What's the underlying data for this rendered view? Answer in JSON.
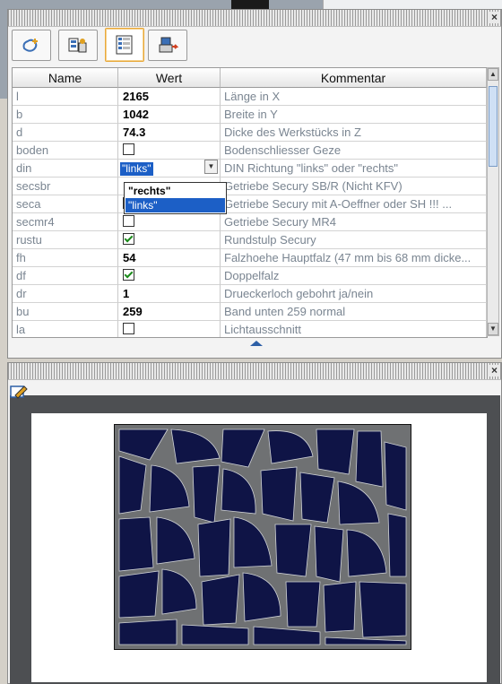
{
  "toolbar_tabs": [
    {
      "icon": "shape-add-icon",
      "active": false
    },
    {
      "icon": "settings-tree-icon",
      "active": false
    },
    {
      "icon": "property-list-icon",
      "active": true
    },
    {
      "icon": "export-icon",
      "active": false
    }
  ],
  "grid": {
    "columns": [
      "Name",
      "Wert",
      "Kommentar"
    ],
    "rows": [
      {
        "name": "l",
        "value": "2165",
        "comment": "Länge in X",
        "type": "text"
      },
      {
        "name": "b",
        "value": "1042",
        "comment": "Breite in Y",
        "type": "text"
      },
      {
        "name": "d",
        "value": "74.3",
        "comment": "Dicke des Werkstücks in Z",
        "type": "text"
      },
      {
        "name": "boden",
        "value": false,
        "comment": "Bodenschliesser Geze",
        "type": "checkbox"
      },
      {
        "name": "din",
        "value": "\"links\"",
        "comment": "DIN Richtung \"links\" oder \"rechts\"",
        "type": "select"
      },
      {
        "name": "secsbr",
        "value": "",
        "comment": "Getriebe Secury SB/R (Nicht KFV)",
        "type": "text"
      },
      {
        "name": "seca",
        "value": true,
        "comment": "Getriebe Secury mit A-Oeffner oder SH     !!! ...",
        "type": "checkbox"
      },
      {
        "name": "secmr4",
        "value": false,
        "comment": "Getriebe Secury MR4",
        "type": "checkbox"
      },
      {
        "name": "rustu",
        "value": true,
        "comment": "Rundstulp Secury",
        "type": "checkbox"
      },
      {
        "name": "fh",
        "value": "54",
        "comment": "Falzhoehe Hauptfalz (47 mm bis 68 mm dicke...",
        "type": "text"
      },
      {
        "name": "df",
        "value": true,
        "comment": "Doppelfalz",
        "type": "checkbox"
      },
      {
        "name": "dr",
        "value": "1",
        "comment": "Drueckerloch gebohrt ja/nein",
        "type": "text"
      },
      {
        "name": "bu",
        "value": "259",
        "comment": "Band unten 259 normal",
        "type": "text"
      },
      {
        "name": "la",
        "value": false,
        "comment": "Lichtausschnitt",
        "type": "checkbox"
      }
    ]
  },
  "dropdown_options": [
    "\"rechts\"",
    "\"links\""
  ],
  "dropdown_selected": "\"links\"",
  "close_glyph": "×",
  "colors": {
    "part_fill": "#0f1446",
    "sheet_bg": "#6f7173",
    "selection": "#1c5fc6"
  }
}
